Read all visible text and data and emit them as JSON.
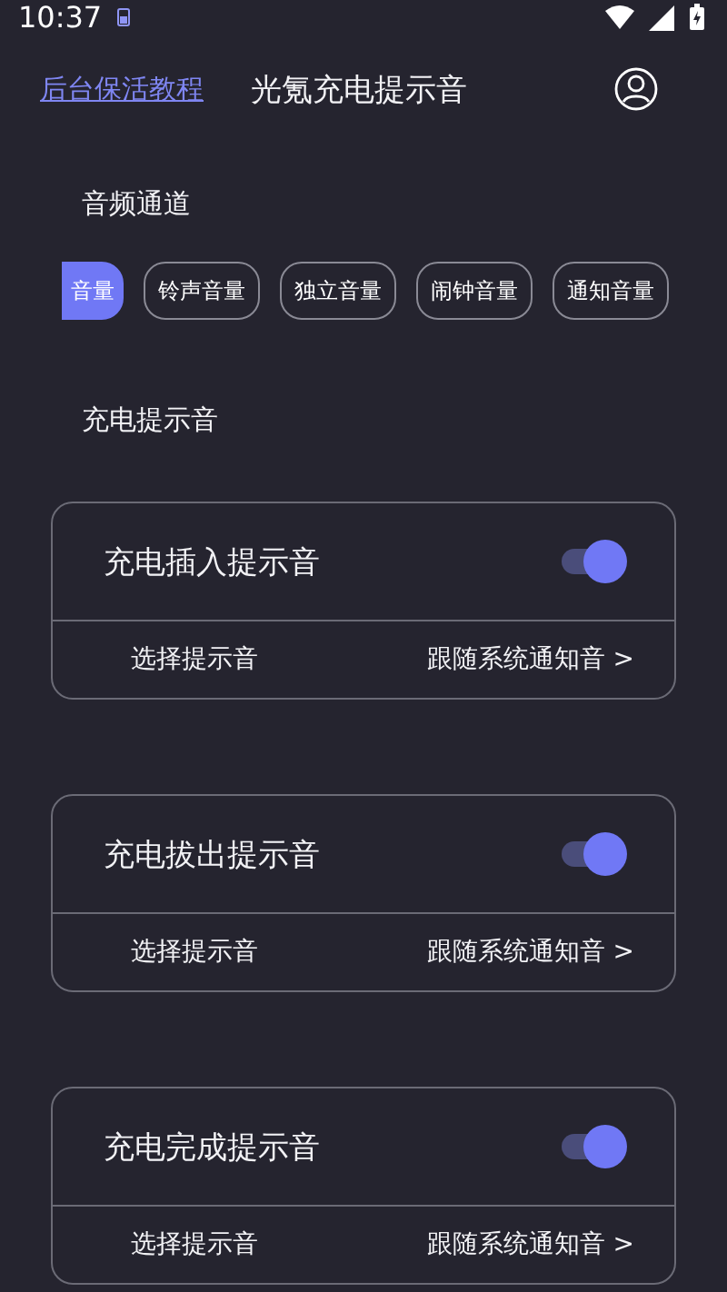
{
  "status_bar": {
    "time": "10:37"
  },
  "header": {
    "link": "后台保活教程",
    "title": "光氪充电提示音"
  },
  "channel_section": {
    "title": "音频通道",
    "chips": [
      {
        "label": "音量",
        "selected": true
      },
      {
        "label": "铃声音量",
        "selected": false
      },
      {
        "label": "独立音量",
        "selected": false
      },
      {
        "label": "闹钟音量",
        "selected": false
      },
      {
        "label": "通知音量",
        "selected": false
      }
    ]
  },
  "sound_section": {
    "title": "充电提示音",
    "cards": [
      {
        "title": "充电插入提示音",
        "on": true,
        "row_label": "选择提示音",
        "row_value": "跟随系统通知音 >"
      },
      {
        "title": "充电拔出提示音",
        "on": true,
        "row_label": "选择提示音",
        "row_value": "跟随系统通知音 >"
      },
      {
        "title": "充电完成提示音",
        "on": true,
        "row_label": "选择提示音",
        "row_value": "跟随系统通知音 >"
      }
    ]
  }
}
